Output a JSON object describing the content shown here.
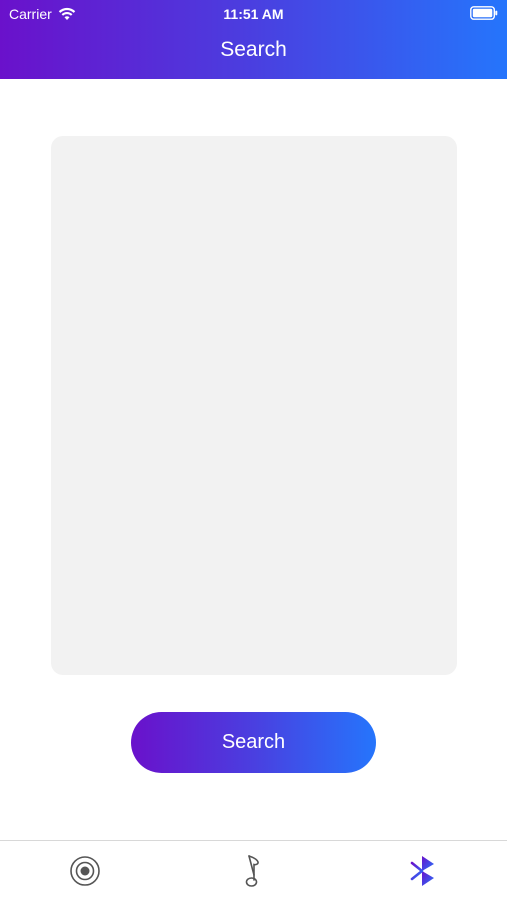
{
  "status_bar": {
    "carrier": "Carrier",
    "time": "11:51 AM",
    "wifi_icon": "wifi-icon",
    "battery_icon": "battery-icon"
  },
  "header": {
    "title": "Search",
    "gradient_start": "#6a11cb",
    "gradient_end": "#2575fc"
  },
  "main": {
    "panel_color": "#f2f2f2",
    "search_button_label": "Search"
  },
  "tab_bar": {
    "items": [
      {
        "icon": "target-icon",
        "active": false
      },
      {
        "icon": "music-note-icon",
        "active": false
      },
      {
        "icon": "bluetooth-icon",
        "active": true
      }
    ],
    "inactive_color": "#555555",
    "active_color": "#3a4ee8"
  }
}
